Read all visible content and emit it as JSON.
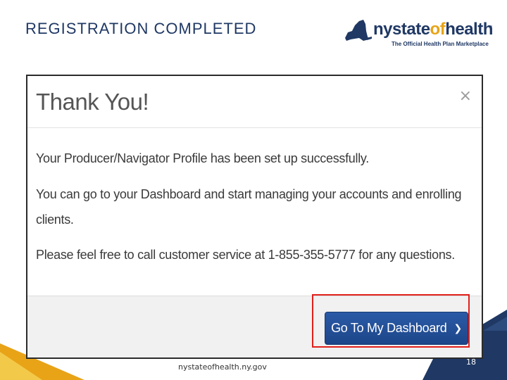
{
  "slide": {
    "title": "REGISTRATION COMPLETED",
    "footer_url": "nystateofhealth.ny.gov",
    "page_number": "18"
  },
  "logo": {
    "wordmark_part1": "nystate",
    "wordmark_part2": "of",
    "wordmark_part3": "health",
    "tagline": "The Official Health Plan Marketplace",
    "trademark": "™"
  },
  "dialog": {
    "title": "Thank You!",
    "close_symbol": "×",
    "messages": [
      "Your Producer/Navigator Profile has been set up successfully.",
      "You can go to your Dashboard and start managing your accounts and enrolling",
      "clients.",
      "Please feel free to call customer service at 1-855-355-5777 for any questions."
    ],
    "primary_button": {
      "label": "Go To My Dashboard",
      "chevron": "❯"
    }
  },
  "colors": {
    "title": "#1f3864",
    "accent_gold": "#e8a317",
    "navy": "#1f3864",
    "highlight": "#e0201b",
    "button": "#1d468a"
  }
}
